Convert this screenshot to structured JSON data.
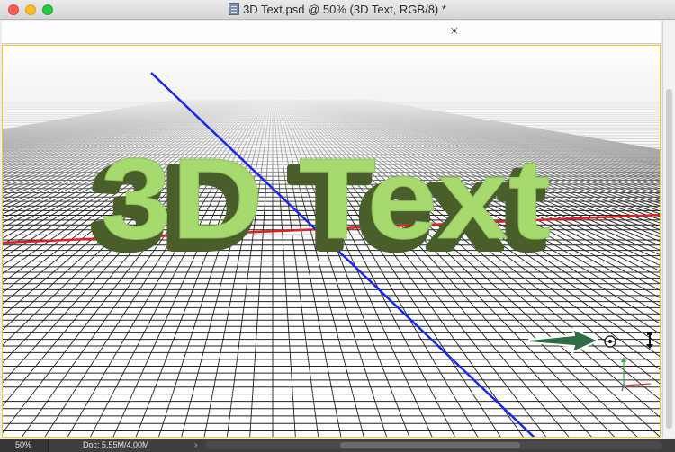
{
  "window": {
    "title": "3D Text.psd @ 50% (3D Text, RGB/8) *"
  },
  "canvas": {
    "text3d": "3D Text",
    "colors": {
      "text_face": "#a6da6e",
      "text_extrusion": "#4a5e2c",
      "grid_line": "#222222",
      "x_axis": "#e02020",
      "z_axis": "#1e28e6",
      "arrow": "#2f6e45",
      "selection_border": "#f0cc2a"
    },
    "icons": {
      "lighting": "sun-icon",
      "widget_orbit": "orbit-icon",
      "widget_light": "light-arrow-icon",
      "pointer": "green-arrow-icon",
      "axis": "axis-gizmo-icon"
    }
  },
  "statusbar": {
    "zoom": "50%",
    "doc_size": "Doc: 5.55M/4.00M",
    "chevron": "›"
  }
}
